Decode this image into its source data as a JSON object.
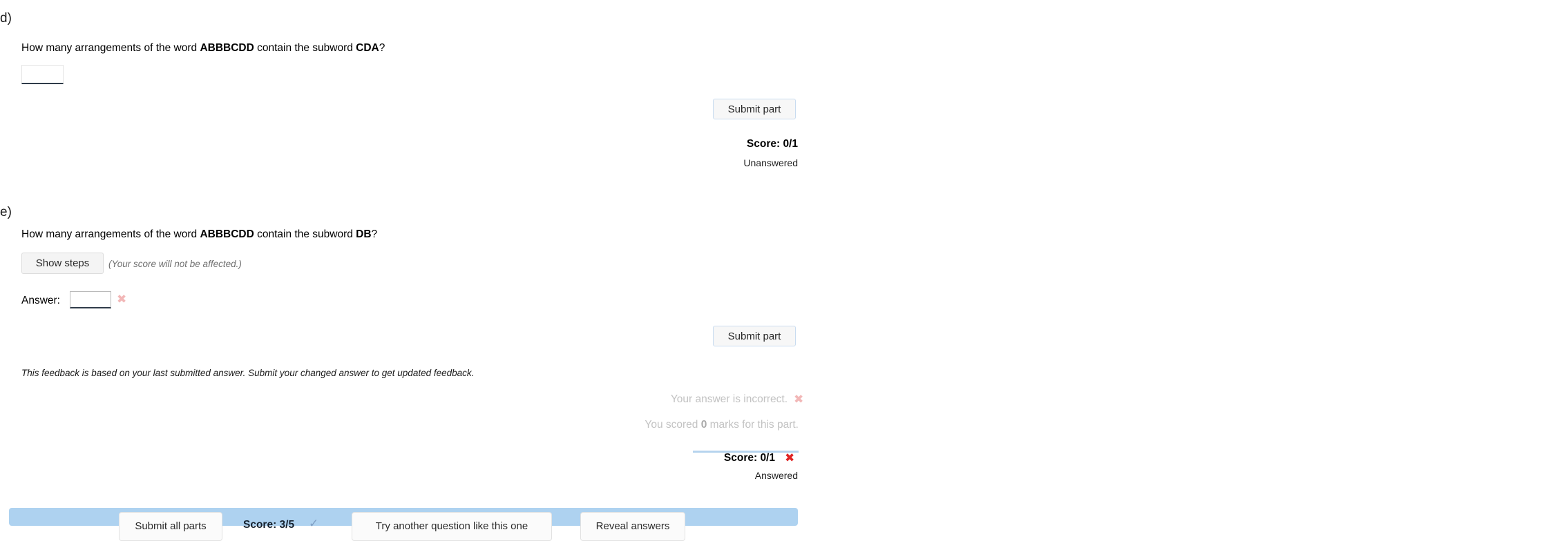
{
  "parts": [
    {
      "letter": "d)",
      "question_prefix": "How many arrangements of the word ",
      "question_word": "ABBBCDD",
      "question_middle": " contain the subword ",
      "question_subword": "CDA",
      "question_suffix": "?",
      "answer_value": "",
      "submit_label": "Submit part",
      "score_label": "Score: 0/1",
      "score_status": "Unanswered"
    },
    {
      "letter": "e)",
      "question_prefix": "How many arrangements of the word ",
      "question_word": "ABBBCDD",
      "question_middle": " contain the subword ",
      "question_subword": "DB",
      "question_suffix": "?",
      "show_steps_label": "Show steps",
      "show_steps_note": "(Your score will not be affected.)",
      "answer_label": "Answer:",
      "answer_value": "",
      "answer_mark": "✖",
      "submit_label": "Submit part",
      "feedback_note": "This feedback is based on your last submitted answer. Submit your changed answer to get updated feedback.",
      "feedback_incorrect": "Your answer is incorrect.",
      "feedback_incorrect_mark": "✖",
      "feedback_marks_prefix": "You scored ",
      "feedback_marks_value": "0",
      "feedback_marks_suffix": " marks for this part.",
      "score_label": "Score: 0/1",
      "score_mark": "✖",
      "score_status": "Answered"
    }
  ],
  "action_bar": {
    "submit_all_label": "Submit all parts",
    "total_score_label": "Score: 3/5",
    "total_score_mark": "✓",
    "try_another_label": "Try another question like this one",
    "reveal_answers_label": "Reveal answers"
  },
  "colors": {
    "bar_background": "#aed2f0",
    "mark_pale_red": "#f2b7b7",
    "mark_red": "#e02424",
    "mark_check_blue": "#7f9fc4",
    "separator_blue": "#b6d4ee"
  }
}
